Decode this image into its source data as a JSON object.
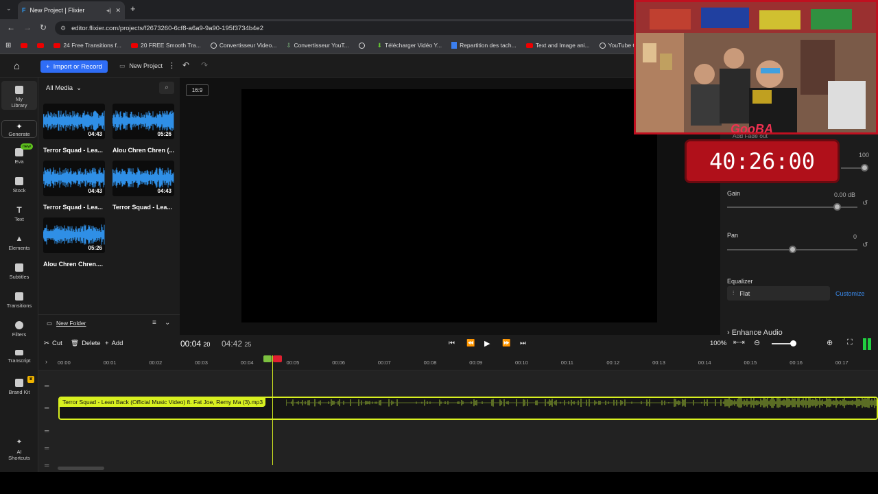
{
  "browser": {
    "tab_title": "New Project | Flixier",
    "url": "editor.flixier.com/projects/f2673260-6cf8-a6a9-9a90-195f3734b4e2",
    "bookmarks": [
      "24 Free Transitions f...",
      "20 FREE Smooth Tra...",
      "Convertisseur Video...",
      "Convertisseur YouT...",
      "",
      "Télécharger Vidéo Y...",
      "Repartition des tach...",
      "Text and Image ani...",
      "YouTube Converter..."
    ]
  },
  "header": {
    "import_label": "Import or Record",
    "new_project_label": "New Project"
  },
  "sidebar": {
    "items": [
      {
        "label": "My Library"
      },
      {
        "label": "Generate"
      },
      {
        "label": "Eva",
        "badge": "new"
      },
      {
        "label": "Stock"
      },
      {
        "label": "Text"
      },
      {
        "label": "Elements"
      },
      {
        "label": "Subtitles"
      },
      {
        "label": "Transitions"
      },
      {
        "label": "Filters"
      },
      {
        "label": "Transcript"
      },
      {
        "label": "Brand Kit"
      },
      {
        "label": "AI Shortcuts"
      }
    ]
  },
  "media": {
    "filter_label": "All Media",
    "items": [
      {
        "name": "Terror Squad - Lea...",
        "duration": "04:43"
      },
      {
        "name": "Alou Chren Chren (...",
        "duration": "05:26"
      },
      {
        "name": "Terror Squad - Lea...",
        "duration": "04:43"
      },
      {
        "name": "Terror Squad - Lea...",
        "duration": "04:43"
      },
      {
        "name": "Alou Chren Chren....",
        "duration": "05:26"
      }
    ],
    "new_folder_label": "New Folder"
  },
  "preview": {
    "aspect_label": "16:9"
  },
  "rpanel": {
    "add_fade_out": "Add Fade out",
    "volume_value": "100",
    "volume_level": 1.0,
    "gain_label": "Gain",
    "gain_value": "0.00 dB",
    "gain_level": 0.84,
    "pan_label": "Pan",
    "pan_value": "0",
    "pan_level": 0.5,
    "equalizer_label": "Equalizer",
    "equalizer_value": "Flat",
    "customize_label": "Customize",
    "enhance_audio_label": "Enhance Audio"
  },
  "overlay": {
    "streamer_tag": "GooBA",
    "timer": "40:26:00"
  },
  "timeline": {
    "cut_label": "Cut",
    "delete_label": "Delete",
    "add_label": "Add",
    "current_time": "00:04",
    "current_frame": "20",
    "total_time": "04:42",
    "total_frame": "25",
    "zoom": "100%",
    "ruler": [
      "00:00",
      "00:01",
      "00:02",
      "00:03",
      "00:04",
      "00:05",
      "00:06",
      "00:07",
      "00:08",
      "00:09",
      "00:10",
      "00:11",
      "00:12",
      "00:13",
      "00:14",
      "00:15",
      "00:16",
      "00:17"
    ],
    "clip_name": "Terror Squad - Lean Back (Official Music Video) ft. Fat Joe, Remy Ma (3).mp3"
  },
  "colors": {
    "accent": "#2f6df6",
    "clip": "#d8f020",
    "timer": "#b0101a"
  }
}
